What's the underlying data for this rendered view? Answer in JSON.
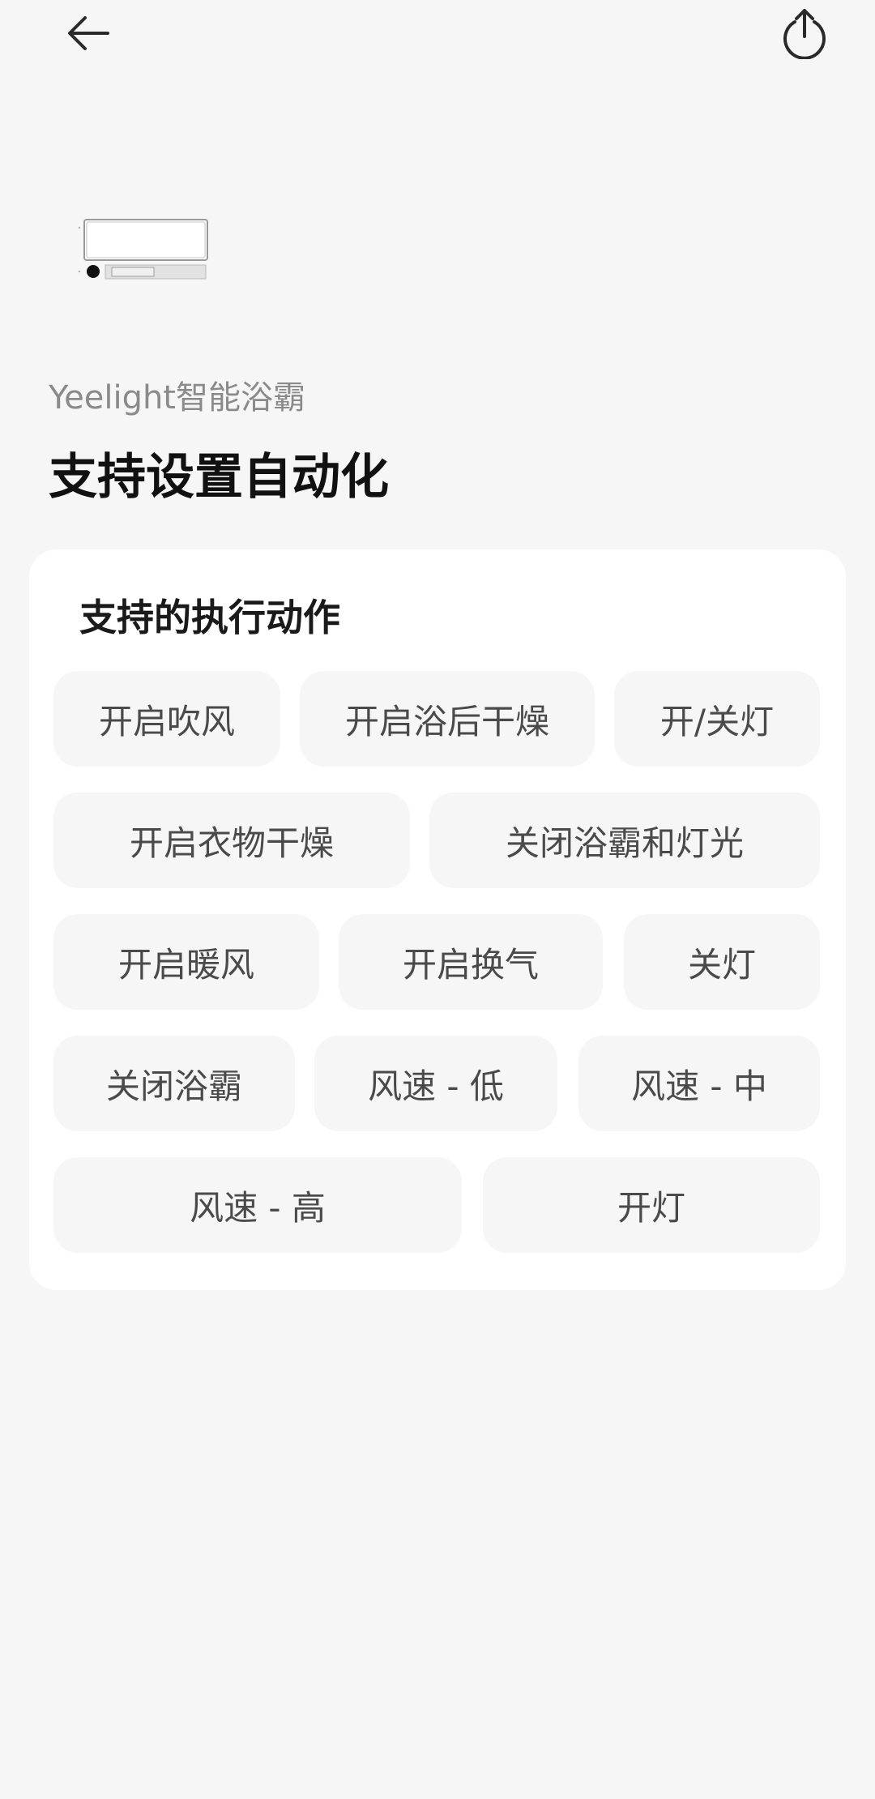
{
  "header": {
    "back_icon": "arrow-left-icon",
    "share_icon": "share-upload-icon"
  },
  "device": {
    "name": "Yeelight智能浴霸",
    "image_icon": "bath-heater-device-icon"
  },
  "page": {
    "title": "支持设置自动化"
  },
  "actions": {
    "section_title": "支持的执行动作",
    "items": [
      {
        "label": "开启吹风"
      },
      {
        "label": "开启浴后干燥"
      },
      {
        "label": "开/关灯"
      },
      {
        "label": "开启衣物干燥"
      },
      {
        "label": "关闭浴霸和灯光"
      },
      {
        "label": "开启暖风"
      },
      {
        "label": "开启换气"
      },
      {
        "label": "关灯"
      },
      {
        "label": "关闭浴霸"
      },
      {
        "label": "风速 - 低"
      },
      {
        "label": "风速 - 中"
      },
      {
        "label": "风速 - 高"
      },
      {
        "label": "开灯"
      }
    ]
  }
}
